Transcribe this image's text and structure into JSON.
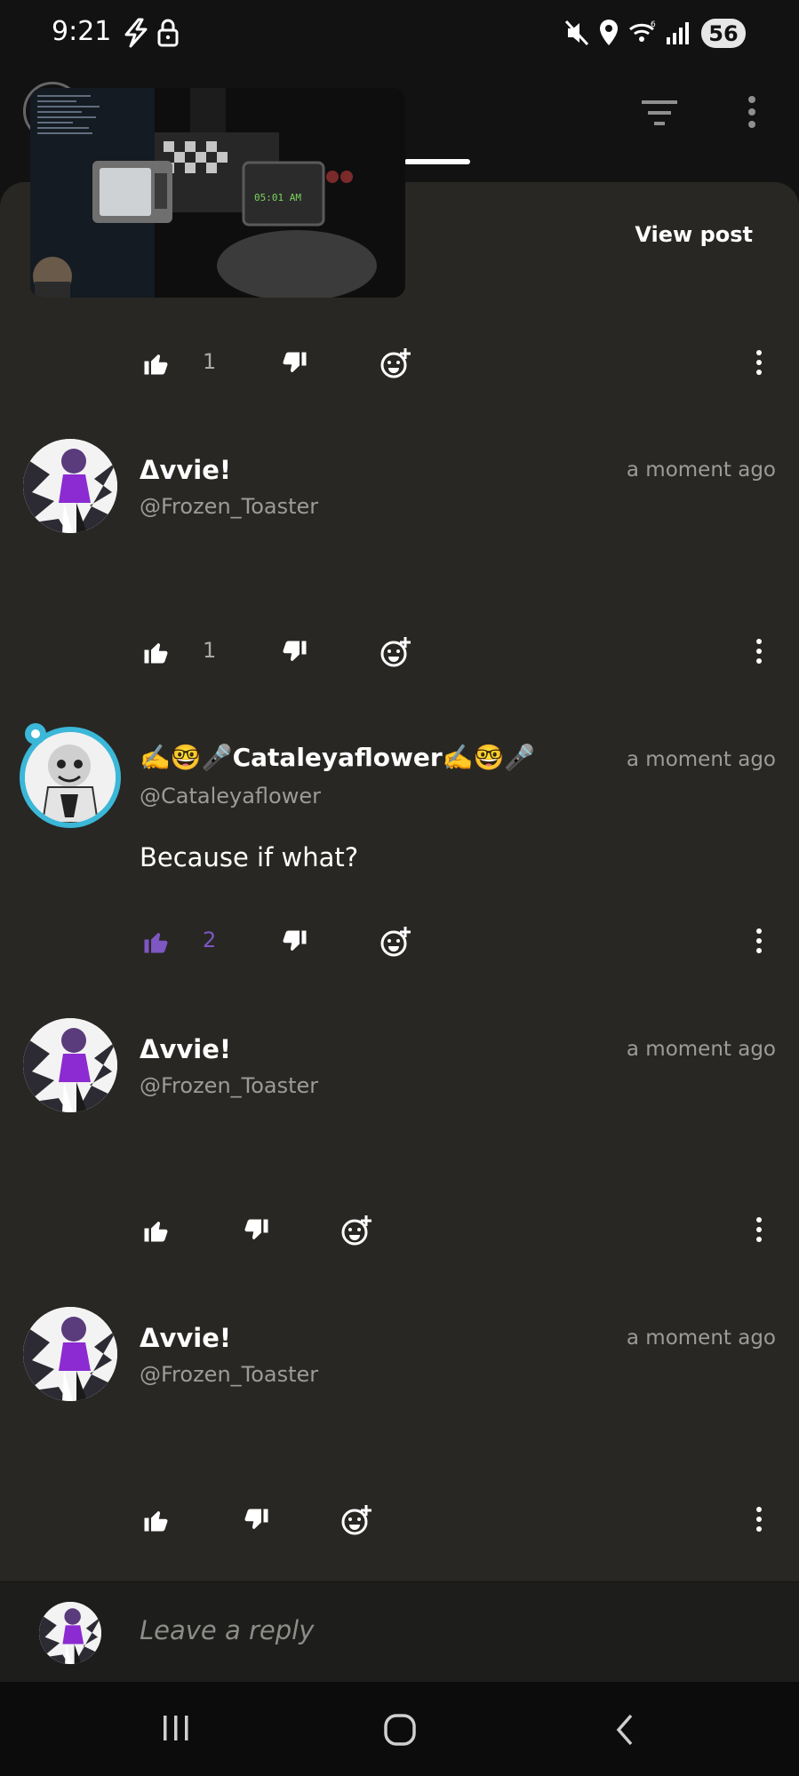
{
  "status_bar": {
    "time": "9:21",
    "battery": "56",
    "icons": [
      "flash-icon",
      "lock-icon",
      "mute-icon",
      "location-icon",
      "wifi-icon",
      "signal-icon"
    ]
  },
  "header": {
    "view_post_label": "View post",
    "pip_clock": "05:01 AM"
  },
  "comments": [
    {
      "likes": "1"
    },
    {
      "name": "Δvvie!",
      "handle": "@Frozen_Toaster",
      "time": "a moment ago",
      "likes": "1"
    },
    {
      "name": "✍️🤓🎤Cataleyaflower✍️🤓🎤",
      "handle": "@Cataleyaflower",
      "time": "a moment ago",
      "body": "Because if what?",
      "likes": "2"
    },
    {
      "name": "Δvvie!",
      "handle": "@Frozen_Toaster",
      "time": "a moment ago"
    },
    {
      "name": "Δvvie!",
      "handle": "@Frozen_Toaster",
      "time": "a moment ago"
    }
  ],
  "reply": {
    "placeholder": "Leave a reply"
  },
  "colors": {
    "panel": "#282723",
    "liked": "#7e57c2",
    "avatar_ring": "#3bb7d8"
  }
}
